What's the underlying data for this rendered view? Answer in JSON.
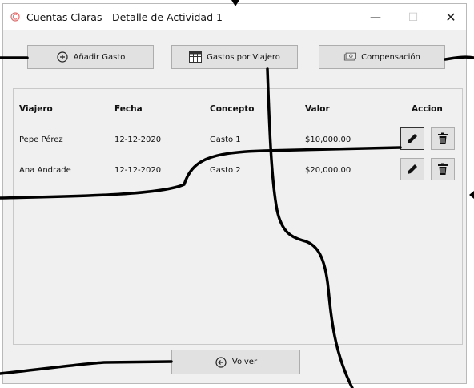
{
  "window": {
    "title": "Cuentas Claras - Detalle de Actividad 1",
    "controls": {
      "minimize": "—",
      "maximize": "☐",
      "close": "✕"
    }
  },
  "toolbar": {
    "add_expense": "Añadir Gasto",
    "expenses_by_traveler": "Gastos por Viajero",
    "compensation": "Compensación"
  },
  "table": {
    "columns": [
      "Viajero",
      "Fecha",
      "Concepto",
      "Valor",
      "Accion"
    ],
    "rows": [
      {
        "traveler": "Pepe Pérez",
        "date": "12-12-2020",
        "concept": "Gasto 1",
        "value": "$10,000.00"
      },
      {
        "traveler": "Ana Andrade",
        "date": "12-12-2020",
        "concept": "Gasto 2",
        "value": "$20,000.00"
      }
    ]
  },
  "footer": {
    "back": "Volver"
  }
}
